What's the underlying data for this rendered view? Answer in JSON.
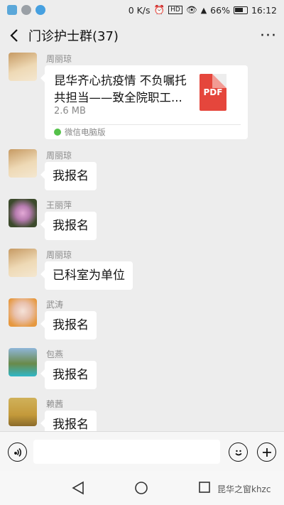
{
  "status_bar": {
    "net_speed": "0 K/s",
    "battery": "66%",
    "time": "16:12"
  },
  "nav": {
    "title": "门诊护士群(37)",
    "back_icon": "chevron-left-icon",
    "more_icon": "more-icon"
  },
  "messages": [
    {
      "sender": "周丽琼",
      "file": {
        "title": "昆华齐心抗疫情 不负嘱托共担当——致全院职工...",
        "size": "2.6 MB",
        "type_label": "PDF",
        "source": "微信电脑版"
      }
    },
    {
      "sender": "周丽琼",
      "text": "我报名"
    },
    {
      "sender": "王丽萍",
      "text": "我报名"
    },
    {
      "sender": "周丽琼",
      "text": "已科室为单位"
    },
    {
      "sender": "武涛",
      "text": "我报名"
    },
    {
      "sender": "包燕",
      "text": "我报名"
    },
    {
      "sender": "赖茜",
      "text": "我报名"
    }
  ],
  "input": {
    "placeholder": ""
  },
  "watermark": "昆华之窗khzc",
  "colors": {
    "background": "#ededed",
    "bubble": "#ffffff",
    "pdf_red": "#e5463c"
  }
}
